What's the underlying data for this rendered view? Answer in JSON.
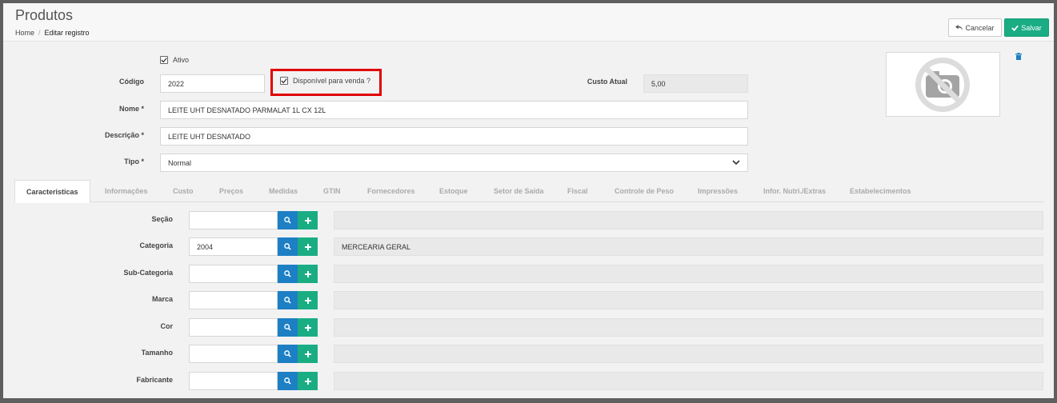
{
  "header": {
    "title": "Produtos",
    "breadcrumb": {
      "home": "Home",
      "separator": "/",
      "current": "Editar registro"
    },
    "cancel_label": "Cancelar",
    "save_label": "Salvar"
  },
  "form": {
    "ativo_label": "Ativo",
    "ativo_checked": true,
    "codigo_label": "Código",
    "codigo_value": "2022",
    "disponivel_label": "Disponível para venda ?",
    "disponivel_checked": true,
    "custo_label": "Custo Atual",
    "custo_value": "5,00",
    "nome_label": "Nome *",
    "nome_value": "LEITE UHT DESNATADO PARMALAT 1L CX 12L",
    "descricao_label": "Descrição *",
    "descricao_value": "LEITE UHT DESNATADO",
    "tipo_label": "Tipo *",
    "tipo_value": "Normal"
  },
  "tabs": [
    {
      "label": "Caracteristicas",
      "active": true
    },
    {
      "label": "Informações"
    },
    {
      "label": "Custo"
    },
    {
      "label": "Preços"
    },
    {
      "label": "Medidas"
    },
    {
      "label": "GTIN"
    },
    {
      "label": "Fornecedores"
    },
    {
      "label": "Estoque"
    },
    {
      "label": "Setor de Saída"
    },
    {
      "label": "Fiscal"
    },
    {
      "label": "Controle de Peso"
    },
    {
      "label": "Impressões"
    },
    {
      "label": "Infor. Nutri./Extras"
    },
    {
      "label": "Estabelecimentos"
    }
  ],
  "lookups": [
    {
      "label": "Seção",
      "code": "",
      "description": ""
    },
    {
      "label": "Categoria",
      "code": "2004",
      "description": "MERCEARIA GERAL"
    },
    {
      "label": "Sub-Categoria",
      "code": "",
      "description": ""
    },
    {
      "label": "Marca",
      "code": "",
      "description": ""
    },
    {
      "label": "Cor",
      "code": "",
      "description": ""
    },
    {
      "label": "Tamanho",
      "code": "",
      "description": ""
    },
    {
      "label": "Fabricante",
      "code": "",
      "description": ""
    }
  ],
  "colors": {
    "primary_blue": "#1d7fc4",
    "success_green": "#1aad84",
    "highlight_red": "#e00000"
  },
  "icons": {
    "cancel": "undo-arrow-icon",
    "save": "check-icon",
    "photo": "no-camera-icon",
    "delete": "trash-icon",
    "search": "search-icon",
    "add": "plus-icon",
    "select": "chevron-down-icon"
  }
}
